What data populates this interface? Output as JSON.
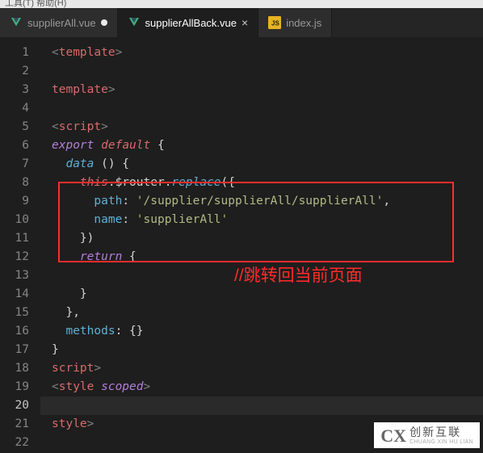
{
  "menu": "工具(T)  帮助(H)",
  "tabs": [
    {
      "icon": "vue",
      "label": "supplierAll.vue",
      "dirty": true,
      "active": false
    },
    {
      "icon": "vue",
      "label": "supplierAllBack.vue",
      "dirty": false,
      "active": true
    },
    {
      "icon": "js",
      "label": "index.js",
      "dirty": false,
      "active": false
    }
  ],
  "lineCount": 22,
  "currentLine": 20,
  "code": {
    "l1": {
      "indent": 0,
      "open": "<",
      "name": "template",
      "close": ">"
    },
    "l2": {
      "indent": 0,
      "text": ""
    },
    "l3": {
      "indent": 0,
      "open": "</",
      "name": "template",
      "close": ">"
    },
    "l4": {
      "indent": 0,
      "text": ""
    },
    "l5": {
      "indent": 0,
      "open": "<",
      "name": "script",
      "close": ">"
    },
    "l6": {
      "indent": 0,
      "kw1": "export",
      "kw2": "default",
      "brace": "{"
    },
    "l7": {
      "indent": 1,
      "fn": "data",
      "rest": " () {"
    },
    "l8": {
      "indent": 2,
      "this": "this",
      "dot1": ".",
      "obj": "$router",
      "dot2": ".",
      "method": "replace",
      "paren": "({"
    },
    "l9": {
      "indent": 3,
      "key": "path",
      "colon": ": ",
      "str": "'/supplier/supplierAll/supplierAll'",
      "comma": ","
    },
    "l10": {
      "indent": 3,
      "key": "name",
      "colon": ": ",
      "str": "'supplierAll'"
    },
    "l11": {
      "indent": 2,
      "text": "})"
    },
    "l12": {
      "indent": 2,
      "kw": "return",
      "brace": " {"
    },
    "l13": {
      "indent": 0,
      "text": ""
    },
    "l14": {
      "indent": 2,
      "text": "}"
    },
    "l15": {
      "indent": 1,
      "text": "},"
    },
    "l16": {
      "indent": 1,
      "key": "methods",
      "rest": ": {}"
    },
    "l17": {
      "indent": 0,
      "text": "}"
    },
    "l18": {
      "indent": 0,
      "open": "</",
      "name": "script",
      "close": ">"
    },
    "l19": {
      "indent": 0,
      "open": "<",
      "name": "style",
      "attr": " scoped",
      "close": ">"
    },
    "l20": {
      "indent": 0,
      "text": ""
    },
    "l21": {
      "indent": 0,
      "open": "</",
      "name": "style",
      "close": ">"
    },
    "l22": {
      "indent": 0,
      "text": ""
    }
  },
  "annotation": "//跳转回当前页面",
  "watermark": {
    "logo": "CX",
    "cn": "创新互联",
    "en": "CHUANG XIN HU LIAN"
  }
}
